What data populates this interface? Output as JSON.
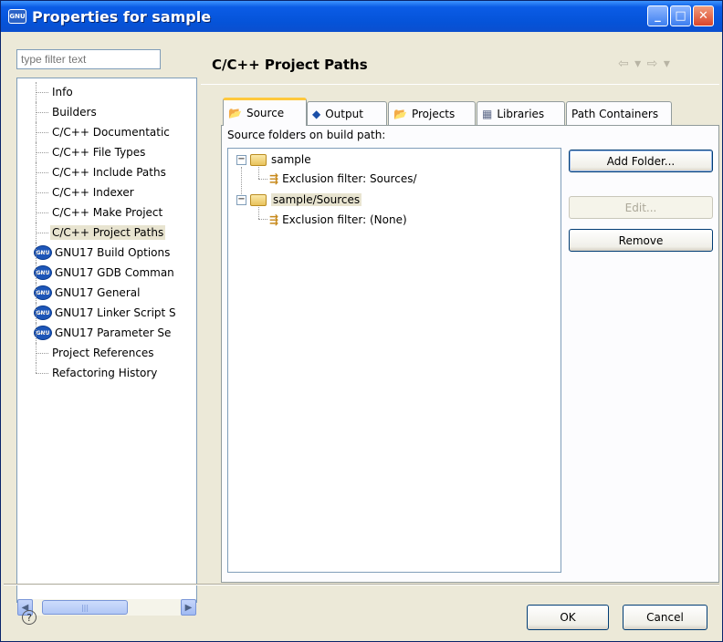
{
  "window": {
    "title": "Properties for sample",
    "app_icon": "GNU"
  },
  "filter": {
    "placeholder": "type filter text"
  },
  "nav_tree": {
    "items": [
      {
        "label": "Info",
        "icon": "none"
      },
      {
        "label": "Builders",
        "icon": "none"
      },
      {
        "label": "C/C++ Documentatic",
        "icon": "none"
      },
      {
        "label": "C/C++ File Types",
        "icon": "none"
      },
      {
        "label": "C/C++ Include Paths",
        "icon": "none"
      },
      {
        "label": "C/C++ Indexer",
        "icon": "none"
      },
      {
        "label": "C/C++ Make Project",
        "icon": "none"
      },
      {
        "label": "C/C++ Project Paths",
        "icon": "none",
        "selected": true
      },
      {
        "label": "GNU17 Build Options",
        "icon": "gnu-icon"
      },
      {
        "label": "GNU17 GDB Comman",
        "icon": "gnu-icon"
      },
      {
        "label": "GNU17 General",
        "icon": "gnu-icon"
      },
      {
        "label": "GNU17 Linker Script S",
        "icon": "gnu-icon"
      },
      {
        "label": "GNU17 Parameter Se",
        "icon": "gnu-icon"
      },
      {
        "label": "Project References",
        "icon": "none"
      },
      {
        "label": "Refactoring History",
        "icon": "none"
      }
    ]
  },
  "page": {
    "title": "C/C++ Project Paths"
  },
  "tabs": [
    {
      "label": "Source",
      "icon": "source-folder-icon",
      "active": true
    },
    {
      "label": "Output",
      "icon": "output-diamond-icon"
    },
    {
      "label": "Projects",
      "icon": "projects-folder-icon"
    },
    {
      "label": "Libraries",
      "icon": "libraries-grid-icon"
    },
    {
      "label": "Path Containers",
      "icon": "none"
    }
  ],
  "source_tab": {
    "label": "Source folders on build path:",
    "tree": [
      {
        "label": "sample",
        "type": "folder"
      },
      {
        "label": "Exclusion filter: Sources/",
        "type": "filter"
      },
      {
        "label": "sample/Sources",
        "type": "folder",
        "selected": true
      },
      {
        "label": "Exclusion filter: (None)",
        "type": "filter"
      }
    ],
    "buttons": {
      "add_folder": "Add Folder...",
      "edit": "Edit...",
      "remove": "Remove"
    }
  },
  "footer": {
    "help": "?",
    "ok": "OK",
    "cancel": "Cancel"
  },
  "colors": {
    "titlebar": "#0553d8",
    "dialog_bg": "#ece9d8",
    "active_tab_accent": "#ffc83c"
  }
}
